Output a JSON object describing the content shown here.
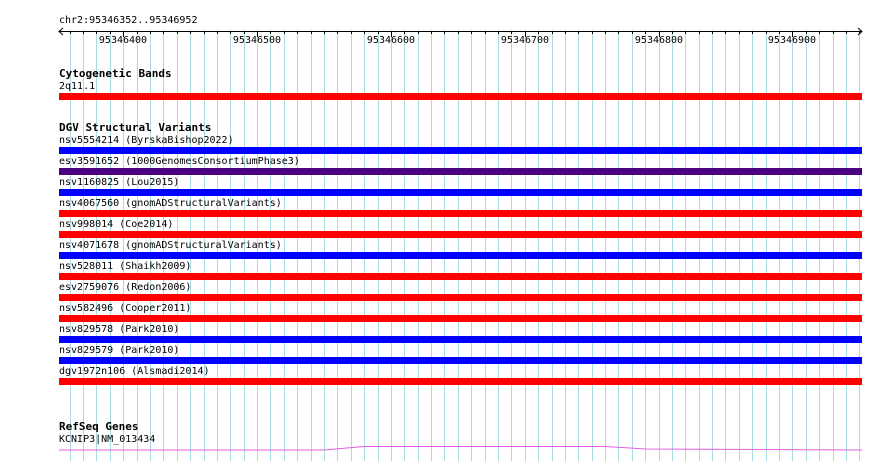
{
  "region": {
    "label": "chr2:95346352..95346952",
    "start": 95346352,
    "end": 95346952,
    "ticks": [
      "95346400",
      "95346500",
      "95346600",
      "95346700",
      "95346800",
      "95346900"
    ]
  },
  "colors": {
    "grid": "#a8dce0",
    "red": "#ff0000",
    "blue": "#0000ff",
    "purple": "#4b0082",
    "magenta": "#e060e0"
  },
  "tracks": {
    "cytoband": {
      "title": "Cytogenetic Bands",
      "features": [
        {
          "label": "2q11.1",
          "color": "red"
        }
      ]
    },
    "dgv": {
      "title": "DGV Structural Variants",
      "features": [
        {
          "label": "nsv5554214 (ByrskaBishop2022)",
          "color": "blue"
        },
        {
          "label": "esv3591652 (1000GenomesConsortiumPhase3)",
          "color": "purple"
        },
        {
          "label": "nsv1160825 (Lou2015)",
          "color": "blue"
        },
        {
          "label": "nsv4067560 (gnomADStructuralVariants)",
          "color": "red"
        },
        {
          "label": "nsv998014 (Coe2014)",
          "color": "red"
        },
        {
          "label": "nsv4071678 (gnomADStructuralVariants)",
          "color": "blue"
        },
        {
          "label": "nsv528011 (Shaikh2009)",
          "color": "red"
        },
        {
          "label": "esv2759076 (Redon2006)",
          "color": "red"
        },
        {
          "label": "nsv582496 (Cooper2011)",
          "color": "red"
        },
        {
          "label": "nsv829578 (Park2010)",
          "color": "blue"
        },
        {
          "label": "nsv829579 (Park2010)",
          "color": "blue"
        },
        {
          "label": "dgv1972n106 (Alsmadi2014)",
          "color": "red"
        }
      ]
    },
    "refseq": {
      "title": "RefSeq Genes",
      "features": [
        {
          "label": "KCNIP3|NM_013434",
          "color": "magenta"
        }
      ]
    }
  }
}
